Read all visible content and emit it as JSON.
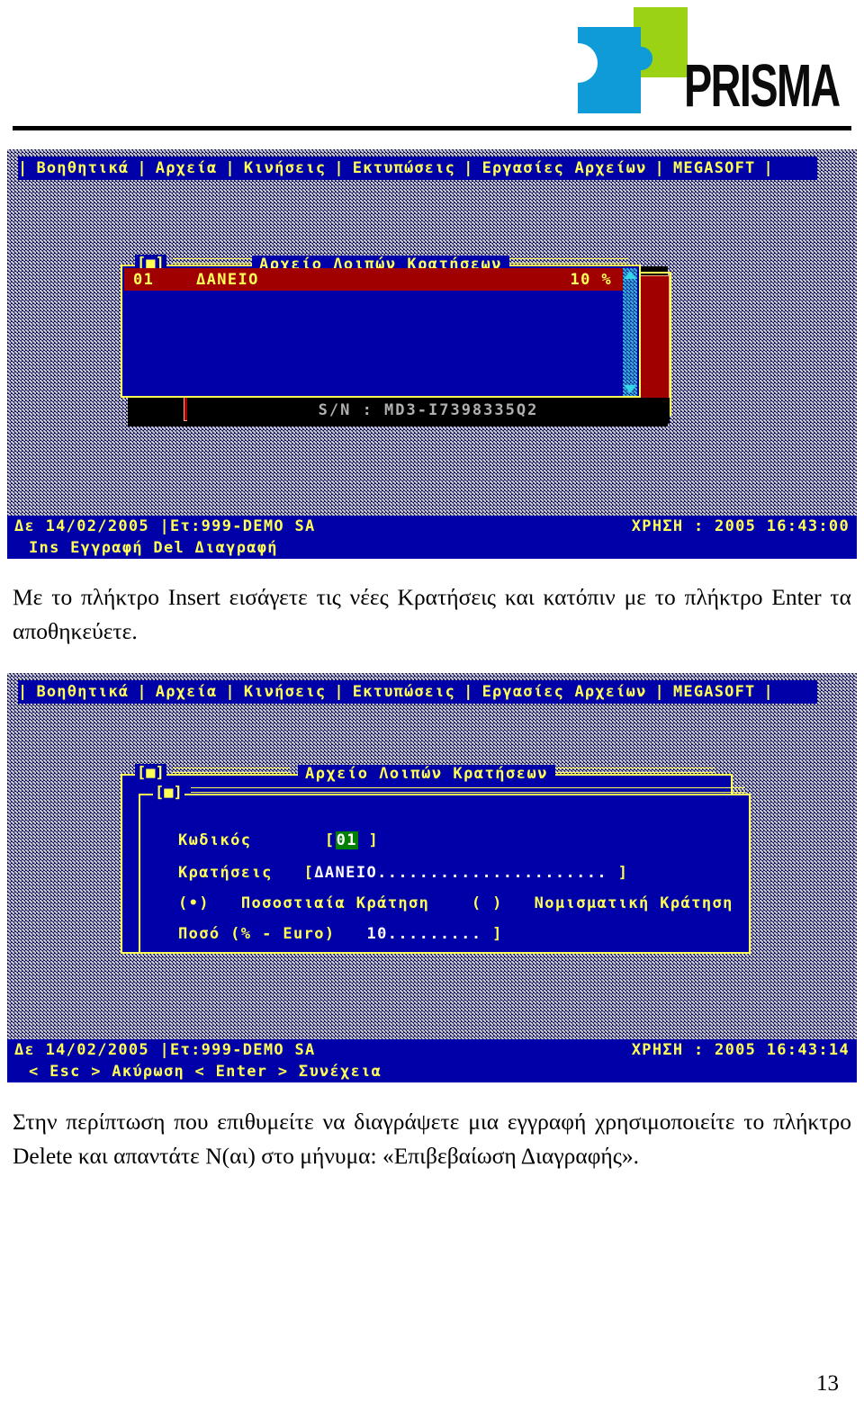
{
  "header": {
    "brand_name": "PRISMA",
    "logo_colors": {
      "blue": "#0f9bd7",
      "green": "#9bd213",
      "text": "#0b0b0b"
    }
  },
  "menubar": {
    "items": [
      "Βοηθητικά",
      "Αρχεία",
      "Κινήσεις",
      "Εκτυπώσεις",
      "Εργασίες Αρχείων",
      "MEGASOFT"
    ],
    "separator": "|"
  },
  "screenshot_1": {
    "window": {
      "close_box": "[■]",
      "title": "Αρχείο Λοιπών Κρατήσεων",
      "row": {
        "code": "01",
        "name": "ΔΑΝΕΙΟ",
        "value": "10 %"
      }
    },
    "serial": "S/N : MD3-I7398335Q2",
    "statusbar": {
      "left": "Δε 14/02/2005 |Ετ:999-DEMO SA",
      "right": "ΧΡΗΣΗ : 2005  16:43:00",
      "keys": "Ins Εγγραφή  Del Διαγραφή"
    }
  },
  "screenshot_2": {
    "window": {
      "close_box": "[■]",
      "title": "Αρχείο Λοιπών Κρατήσεων",
      "inner_close_box": "[■]"
    },
    "form": {
      "code_label": "Κωδικός",
      "code_open": "[",
      "code_value": "01",
      "code_pad": " ",
      "code_close": "]",
      "name_label": "Κρατήσεις",
      "name_open": "[",
      "name_value": "ΔΑΝΕΙΟ",
      "name_dots": "......................",
      "name_close": "]",
      "radio_selected": "(•)",
      "radio_selected_label": "Ποσοστιαία Κράτηση",
      "radio_unselected": "( )",
      "radio_unselected_label": "Νομισματική Κράτηση",
      "amount_label": "Ποσό (% - Euro)",
      "amount_value": "10",
      "amount_dots": ".........",
      "amount_close": "]"
    },
    "statusbar": {
      "left": "Δε 14/02/2005 |Ετ:999-DEMO SA",
      "right": "ΧΡΗΣΗ : 2005  16:43:14",
      "keys": "< Esc > Ακύρωση  < Enter > Συνέχεια"
    }
  },
  "body": {
    "paragraph_1": "Με το πλήκτρο Insert εισάγετε τις νέες Κρατήσεις και κατόπιν με το πλήκτρο Enter τα αποθηκεύετε.",
    "paragraph_2": "Στην περίπτωση που επιθυμείτε να διαγράψετε μια εγγραφή χρησιμοποιείτε το πλήκτρο Delete και απαντάτε Ν(αι) στο μήνυμα: «Επιβεβαίωση Διαγραφής»."
  },
  "page_number": "13"
}
